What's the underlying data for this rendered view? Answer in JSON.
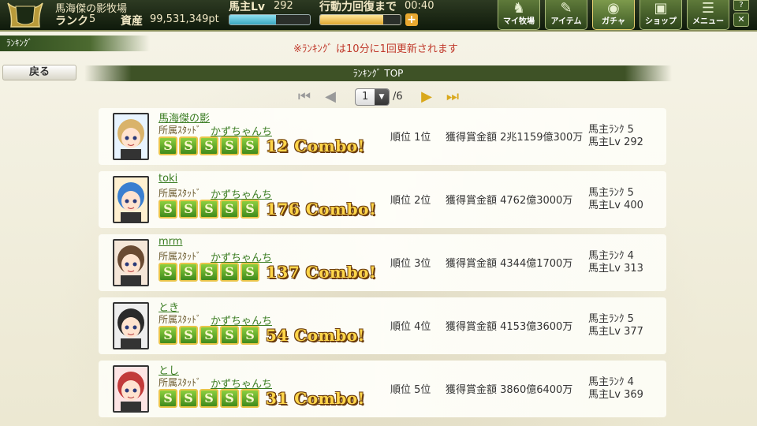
{
  "header": {
    "farm_name": "馬海傑の影牧場",
    "rank_label": "ランク",
    "rank_value": "5",
    "asset_label": "資産",
    "asset_value": "99,531,349pt",
    "lv_label": "馬主Lv",
    "lv_value": "292",
    "lv_progress": 0.58,
    "ap_label": "行動力回復まで",
    "ap_time": "00:40",
    "ap_progress": 0.78,
    "ap_plus": "+",
    "nav": [
      {
        "label": "マイ牧場",
        "icon": "horse-icon"
      },
      {
        "label": "アイテム",
        "icon": "pen-icon"
      },
      {
        "label": "ガチャ",
        "icon": "gacha-icon"
      },
      {
        "label": "ショップ",
        "icon": "shop-bag-icon"
      },
      {
        "label": "メニュー",
        "icon": "menu-list-icon"
      }
    ],
    "help": "?",
    "mute": "✕"
  },
  "section_tab": "ﾗﾝｷﾝｸﾞ",
  "notice": "※ﾗﾝｷﾝｸﾞ は10分に1回更新されます",
  "back_label": "戻る",
  "title": "ﾗﾝｷﾝｸﾞ TOP",
  "pager": {
    "current": "1",
    "total": "/6",
    "first": "⏮",
    "prev": "◀",
    "next": "▶",
    "last": "⏭"
  },
  "rows": [
    {
      "name": "馬海傑の影",
      "stable_label": "所属ｽﾀｯﾄﾞ",
      "stable": "かずちゃんち",
      "badges": [
        "S",
        "S",
        "S",
        "S",
        "S"
      ],
      "combo": "12 Combo!",
      "place": "順位 1位",
      "prize": "獲得賞金額 2兆1159億300万",
      "owner_rank": "馬主ﾗﾝｸ 5",
      "owner_lv": "馬主Lv  292"
    },
    {
      "name": "toki",
      "stable_label": "所属ｽﾀｯﾄﾞ",
      "stable": "かずちゃんち",
      "badges": [
        "S",
        "S",
        "S",
        "S",
        "S"
      ],
      "combo": "176 Combo!",
      "place": "順位 2位",
      "prize": "獲得賞金額 4762億3000万",
      "owner_rank": "馬主ﾗﾝｸ 5",
      "owner_lv": "馬主Lv  400"
    },
    {
      "name": "mrm",
      "stable_label": "所属ｽﾀｯﾄﾞ",
      "stable": "かずちゃんち",
      "badges": [
        "S",
        "S",
        "S",
        "S",
        "S"
      ],
      "combo": "137 Combo!",
      "place": "順位 3位",
      "prize": "獲得賞金額 4344億1700万",
      "owner_rank": "馬主ﾗﾝｸ 4",
      "owner_lv": "馬主Lv  313"
    },
    {
      "name": "とき",
      "stable_label": "所属ｽﾀｯﾄﾞ",
      "stable": "かずちゃんち",
      "badges": [
        "S",
        "S",
        "S",
        "S",
        "S"
      ],
      "combo": "54 Combo!",
      "place": "順位 4位",
      "prize": "獲得賞金額 4153億3600万",
      "owner_rank": "馬主ﾗﾝｸ 5",
      "owner_lv": "馬主Lv  377"
    },
    {
      "name": "とし",
      "stable_label": "所属ｽﾀｯﾄﾞ",
      "stable": "かずちゃんち",
      "badges": [
        "S",
        "S",
        "S",
        "S",
        "S"
      ],
      "combo": "31 Combo!",
      "place": "順位 5位",
      "prize": "獲得賞金額 3860億6400万",
      "owner_rank": "馬主ﾗﾝｸ 4",
      "owner_lv": "馬主Lv  369"
    }
  ]
}
